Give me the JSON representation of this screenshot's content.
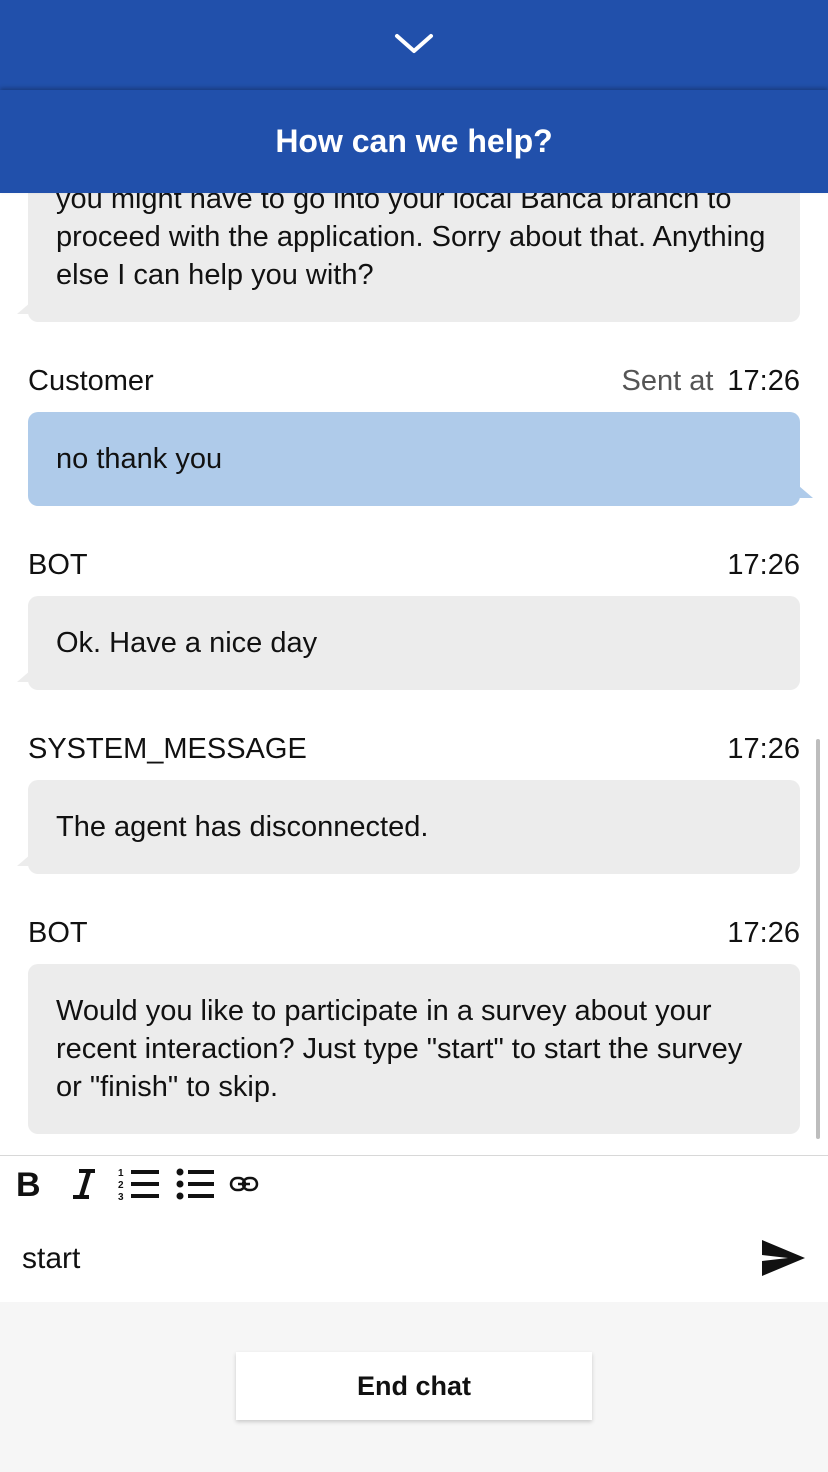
{
  "header": {
    "title": "How can we help?",
    "collapse_icon": "chevron-down-icon"
  },
  "messages": [
    {
      "text": "you might have to go into your local Banca branch to proceed with the application. Sorry about that. Anything else I can help you with?"
    },
    {
      "sender": "Customer",
      "sent_at_label": "Sent at",
      "time": "17:26",
      "text": "no thank you"
    },
    {
      "sender": "BOT",
      "time": "17:26",
      "text": "Ok. Have a nice day"
    },
    {
      "sender": "SYSTEM_MESSAGE",
      "time": "17:26",
      "text": "The agent has disconnected."
    },
    {
      "sender": "BOT",
      "time": "17:26",
      "text": "Would you like to participate in a survey about your recent interaction? Just type \"start\" to start the survey or \"finish\" to skip."
    }
  ],
  "toolbar": {
    "icons": [
      "bold-icon",
      "italic-icon",
      "numbered-list-icon",
      "bullet-list-icon",
      "link-icon"
    ]
  },
  "composer": {
    "value": "start",
    "send_icon": "send-icon"
  },
  "footer": {
    "end_chat_label": "End chat"
  },
  "colors": {
    "brand": "#2150ab",
    "customer_bubble": "#afcbea",
    "bot_bubble": "#ececec"
  }
}
